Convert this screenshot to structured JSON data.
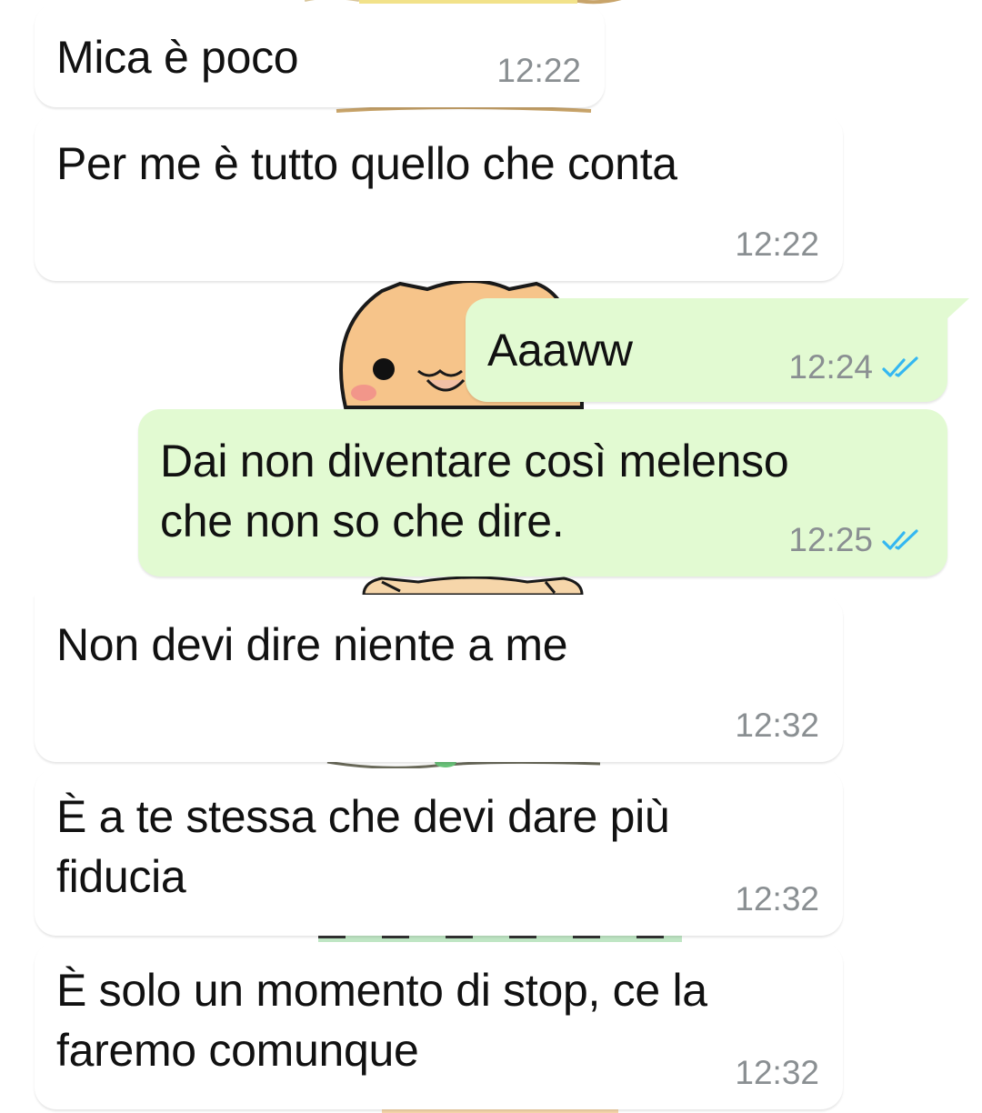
{
  "messages": [
    {
      "direction": "incoming",
      "text": "Mica è poco",
      "time": "12:22"
    },
    {
      "direction": "incoming",
      "text": "Per me è tutto quello che conta",
      "time": "12:22"
    },
    {
      "direction": "outgoing",
      "text": "Aaaww",
      "time": "12:24",
      "status": "read"
    },
    {
      "direction": "outgoing",
      "lines": [
        "Dai non diventare così melenso",
        "che non so che dire."
      ],
      "time": "12:25",
      "status": "read"
    },
    {
      "direction": "incoming",
      "text": "Non devi dire niente a me",
      "time": "12:32"
    },
    {
      "direction": "incoming",
      "lines": [
        "È a te stessa che devi dare più",
        "fiducia"
      ],
      "time": "12:32"
    },
    {
      "direction": "incoming",
      "lines": [
        "È solo un momento di stop, ce la",
        "faremo comunque"
      ],
      "time": "12:32"
    }
  ],
  "colors": {
    "incoming_bubble": "#ffffff",
    "outgoing_bubble": "#e2fad2",
    "read_ticks": "#34b7f1",
    "timestamp": "#8a8f92"
  },
  "icons": {
    "read_status": "double-check-icon",
    "wallpaper": "cartoon-hamster-wallpaper"
  }
}
